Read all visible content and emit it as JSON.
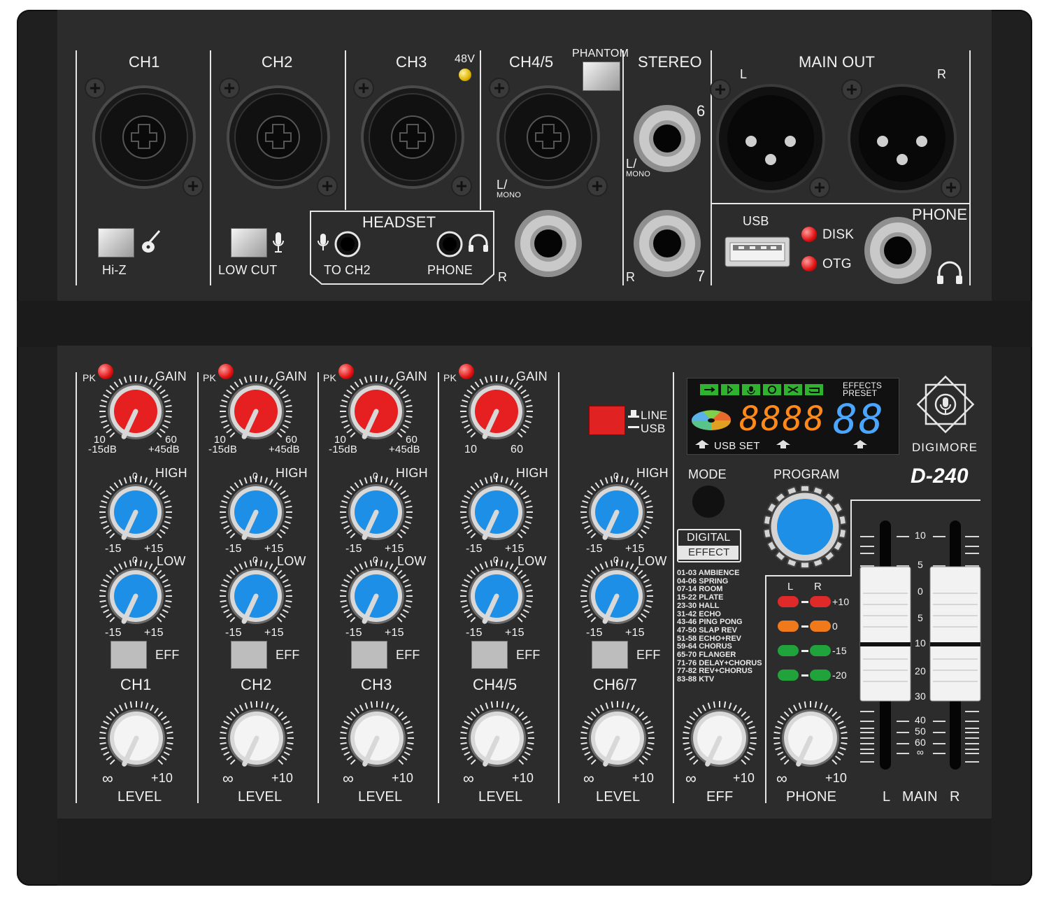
{
  "device": {
    "brand": "DIGIMORE",
    "model": "D-240"
  },
  "rear_panel": {
    "channels": [
      "CH1",
      "CH2",
      "CH3",
      "CH4/5"
    ],
    "phantom_label": "48V",
    "phantom_button_label": "PHANTOM",
    "hiz_label": "Hi-Z",
    "lowcut_label": "LOW CUT",
    "headset": {
      "title": "HEADSET",
      "left_label": "TO CH2",
      "right_label": "PHONE"
    },
    "ch45_left_label": "L/",
    "ch45_mono_label": "MONO",
    "ch45_right_label": "R",
    "stereo": {
      "title": "STEREO",
      "num_top": "6",
      "num_bottom": "7",
      "left_label": "L/",
      "mono_label": "MONO",
      "right_label": "R"
    },
    "main_out": {
      "title": "MAIN OUT",
      "left": "L",
      "right": "R"
    },
    "usb": {
      "label": "USB",
      "disk": "DISK",
      "otg": "OTG"
    },
    "phone_label": "PHONE"
  },
  "strips": [
    {
      "name": "CH1",
      "pk": "PK",
      "gain": "GAIN",
      "gain_min": "10",
      "gain_max": "60",
      "gain_db_min": "-15dB",
      "gain_db_max": "+45dB",
      "high": "HIGH",
      "low": "LOW",
      "eq_zero": "0",
      "eq_min": "-15",
      "eq_max": "+15",
      "eff": "EFF",
      "level_min": "∞",
      "level_max": "+10",
      "level": "LEVEL"
    },
    {
      "name": "CH2",
      "pk": "PK",
      "gain": "GAIN",
      "gain_min": "10",
      "gain_max": "60",
      "gain_db_min": "-15dB",
      "gain_db_max": "+45dB",
      "high": "HIGH",
      "low": "LOW",
      "eq_zero": "0",
      "eq_min": "-15",
      "eq_max": "+15",
      "eff": "EFF",
      "level_min": "∞",
      "level_max": "+10",
      "level": "LEVEL"
    },
    {
      "name": "CH3",
      "pk": "PK",
      "gain": "GAIN",
      "gain_min": "10",
      "gain_max": "60",
      "gain_db_min": "-15dB",
      "gain_db_max": "+45dB",
      "high": "HIGH",
      "low": "LOW",
      "eq_zero": "0",
      "eq_min": "-15",
      "eq_max": "+15",
      "eff": "EFF",
      "level_min": "∞",
      "level_max": "+10",
      "level": "LEVEL"
    },
    {
      "name": "CH4/5",
      "pk": "PK",
      "gain": "GAIN",
      "gain_min": "10",
      "gain_max": "60",
      "gain_db_min": "",
      "gain_db_max": "",
      "high": "HIGH",
      "low": "LOW",
      "eq_zero": "0",
      "eq_min": "-15",
      "eq_max": "+15",
      "eff": "EFF",
      "level_min": "∞",
      "level_max": "+10",
      "level": "LEVEL"
    },
    {
      "name": "CH6/7",
      "pk": "",
      "gain": "",
      "gain_min": "",
      "gain_max": "",
      "gain_db_min": "",
      "gain_db_max": "",
      "high": "HIGH",
      "low": "LOW",
      "eq_zero": "0",
      "eq_min": "-15",
      "eq_max": "+15",
      "eff": "EFF",
      "level_min": "∞",
      "level_max": "+10",
      "level": "LEVEL"
    }
  ],
  "line_usb": {
    "line": "LINE",
    "usb": "USB"
  },
  "display": {
    "digits": "8888",
    "preset_digits": "88",
    "effects_label_1": "EFFECTS",
    "effects_label_2": "PRESET",
    "usb_set": "USB SET",
    "segment_color": "#ff8a1a",
    "preset_color": "#4aa6ff"
  },
  "effects_section": {
    "mode": "MODE",
    "program": "PROGRAM",
    "digital_1": "DIGITAL",
    "digital_2": "EFFECT",
    "list": [
      "01-03 AMBIENCE",
      "04-06 SPRING",
      "07-14 ROOM",
      "15-22 PLATE",
      "23-30 HALL",
      "31-42 ECHO",
      "43-46 PING PONG",
      "47-50 SLAP REV",
      "51-58 ECHO+REV",
      "59-64 CHORUS",
      "65-70 FLANGER",
      "71-76 DELAY+CHORUS",
      "77-82 REV+CHORUS",
      "83-88 KTV"
    ],
    "eff_knob": {
      "min": "∞",
      "max": "+10",
      "label": "EFF"
    }
  },
  "meter": {
    "l": "L",
    "r": "R",
    "levels": [
      "+10",
      "0",
      "-15",
      "-20"
    ],
    "colors": [
      "#e02a2a",
      "#f07a1a",
      "#1fa33a",
      "#1fa33a"
    ]
  },
  "phone_knob": {
    "min": "∞",
    "max": "+10",
    "label": "PHONE"
  },
  "main": {
    "scale": [
      "10",
      "5",
      "0",
      "5",
      "10",
      "20",
      "30",
      "40",
      "50",
      "60",
      "∞"
    ],
    "l": "L",
    "label": "MAIN",
    "r": "R"
  }
}
